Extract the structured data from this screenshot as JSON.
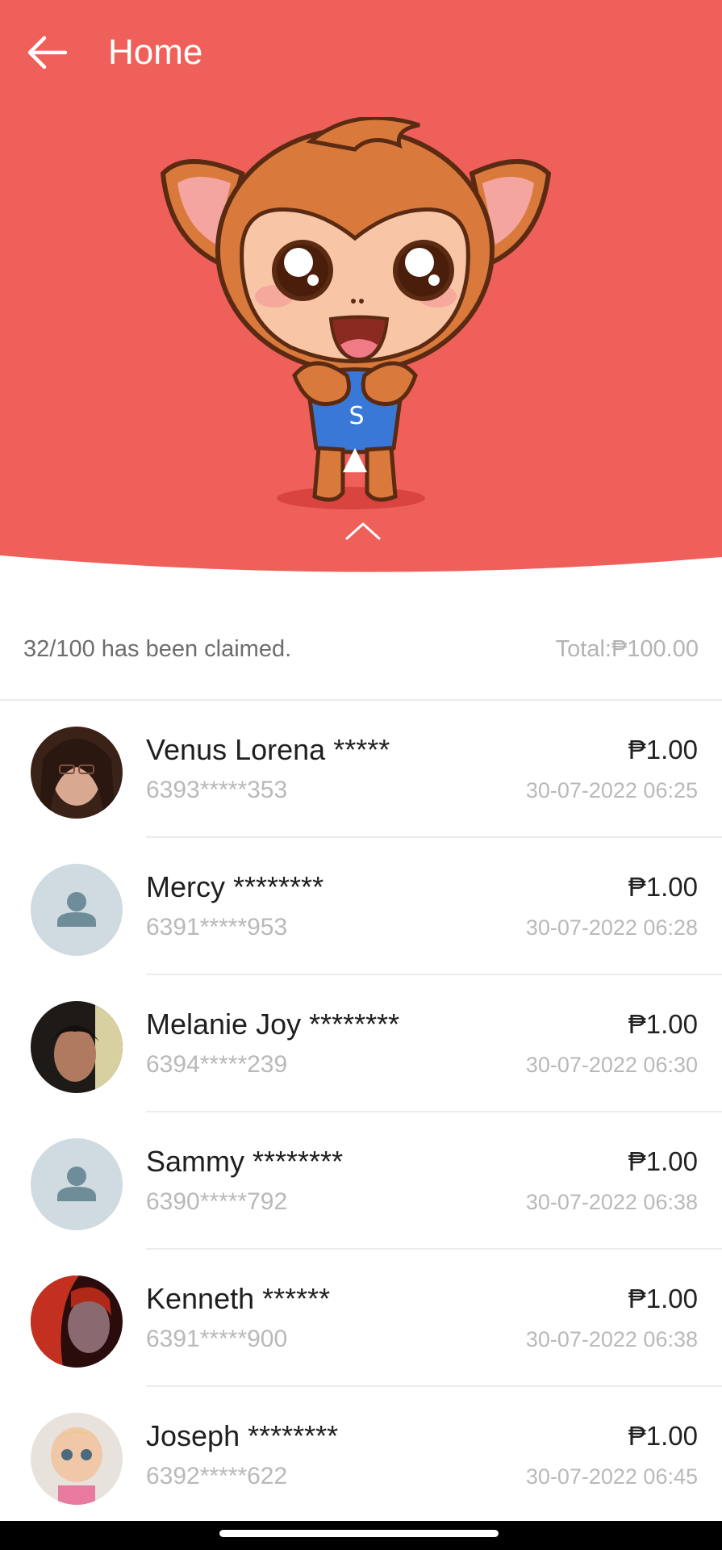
{
  "header": {
    "title": "Home",
    "back_icon": "arrow-left-icon"
  },
  "colors": {
    "hero_bg": "#f0605a",
    "accent": "#f0605a"
  },
  "summary": {
    "claimed_text": "32/100 has been claimed.",
    "total_text": "Total:₱100.00"
  },
  "claims": [
    {
      "name": "Venus Lorena *****",
      "phone": "6393*****353",
      "amount": "₱1.00",
      "time": "30-07-2022 06:25",
      "avatar": "photo"
    },
    {
      "name": "Mercy ********",
      "phone": "6391*****953",
      "amount": "₱1.00",
      "time": "30-07-2022 06:28",
      "avatar": "default-user-icon"
    },
    {
      "name": "Melanie Joy ********",
      "phone": "6394*****239",
      "amount": "₱1.00",
      "time": "30-07-2022 06:30",
      "avatar": "photo"
    },
    {
      "name": "Sammy ********",
      "phone": "6390*****792",
      "amount": "₱1.00",
      "time": "30-07-2022 06:38",
      "avatar": "default-user-icon"
    },
    {
      "name": "Kenneth ******",
      "phone": "6391*****900",
      "amount": "₱1.00",
      "time": "30-07-2022 06:38",
      "avatar": "photo"
    },
    {
      "name": "Joseph ********",
      "phone": "6392*****622",
      "amount": "₱1.00",
      "time": "30-07-2022 06:45",
      "avatar": "photo"
    }
  ]
}
